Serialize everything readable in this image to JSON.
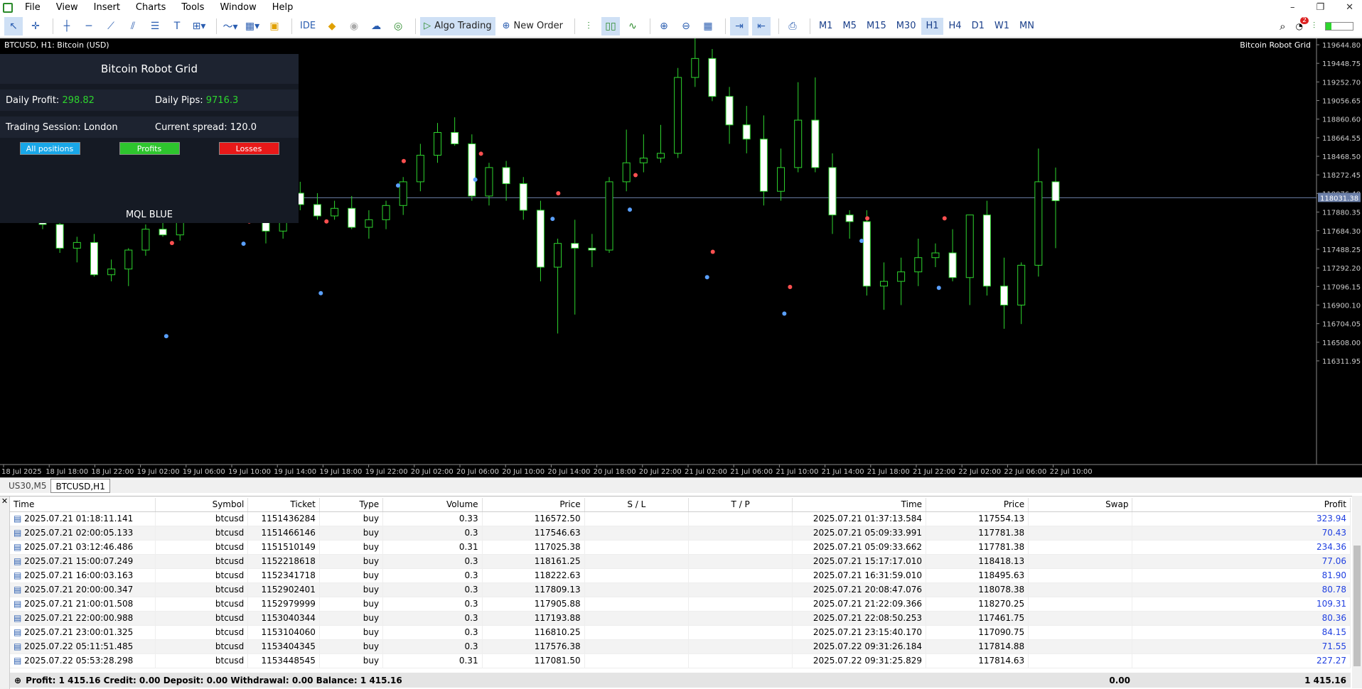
{
  "menu": [
    "File",
    "View",
    "Insert",
    "Charts",
    "Tools",
    "Window",
    "Help"
  ],
  "toolbar": {
    "ide": "IDE",
    "algo": "Algo Trading",
    "new_order": "New Order",
    "timeframes": [
      "M1",
      "M5",
      "M15",
      "M30",
      "H1",
      "H4",
      "D1",
      "W1",
      "MN"
    ],
    "active_tf": "H1",
    "notif_count": "2"
  },
  "chart": {
    "title": "BTCUSD, H1:  Bitcoin (USD)",
    "ea_name": "Bitcoin Robot Grid",
    "price_labels": [
      "119644.80",
      "119448.75",
      "119252.70",
      "119056.65",
      "118860.60",
      "118664.55",
      "118468.50",
      "118272.45",
      "118076.40",
      "117880.35",
      "117684.30",
      "117488.25",
      "117292.20",
      "117096.15",
      "116900.10",
      "116704.05",
      "116508.00",
      "116311.95"
    ],
    "current_price": "118031.38",
    "time_labels": [
      "18 Jul 2025",
      "18 Jul 18:00",
      "18 Jul 22:00",
      "19 Jul 02:00",
      "19 Jul 06:00",
      "19 Jul 10:00",
      "19 Jul 14:00",
      "19 Jul 18:00",
      "19 Jul 22:00",
      "20 Jul 02:00",
      "20 Jul 06:00",
      "20 Jul 10:00",
      "20 Jul 14:00",
      "20 Jul 18:00",
      "20 Jul 22:00",
      "21 Jul 02:00",
      "21 Jul 06:00",
      "21 Jul 10:00",
      "21 Jul 14:00",
      "21 Jul 18:00",
      "21 Jul 22:00",
      "22 Jul 02:00",
      "22 Jul 06:00",
      "22 Jul 10:00"
    ]
  },
  "panel": {
    "title": "Bitcoin Robot Grid",
    "daily_profit_label": "Daily Profit:",
    "daily_profit": "298.82",
    "daily_pips_label": "Daily Pips:",
    "daily_pips": "9716.3",
    "session": "Trading Session: London",
    "spread": "Current spread: 120.0",
    "btn_all": "All positions",
    "btn_profits": "Profits",
    "btn_losses": "Losses",
    "footer": "MQL BLUE"
  },
  "chart_tabs": [
    "US30,M5",
    "BTCUSD,H1"
  ],
  "table": {
    "headers": [
      "Time",
      "Symbol",
      "Ticket",
      "Type",
      "Volume",
      "Price",
      "S / L",
      "T / P",
      "Time",
      "Price",
      "Swap",
      "Profit"
    ],
    "rows": [
      [
        "2025.07.21 01:18:11.141",
        "btcusd",
        "1151436284",
        "buy",
        "0.33",
        "116572.50",
        "",
        "",
        "2025.07.21 01:37:13.584",
        "117554.13",
        "",
        "323.94"
      ],
      [
        "2025.07.21 02:00:05.133",
        "btcusd",
        "1151466146",
        "buy",
        "0.3",
        "117546.63",
        "",
        "",
        "2025.07.21 05:09:33.991",
        "117781.38",
        "",
        "70.43"
      ],
      [
        "2025.07.21 03:12:46.486",
        "btcusd",
        "1151510149",
        "buy",
        "0.31",
        "117025.38",
        "",
        "",
        "2025.07.21 05:09:33.662",
        "117781.38",
        "",
        "234.36"
      ],
      [
        "2025.07.21 15:00:07.249",
        "btcusd",
        "1152218618",
        "buy",
        "0.3",
        "118161.25",
        "",
        "",
        "2025.07.21 15:17:17.010",
        "118418.13",
        "",
        "77.06"
      ],
      [
        "2025.07.21 16:00:03.163",
        "btcusd",
        "1152341718",
        "buy",
        "0.3",
        "118222.63",
        "",
        "",
        "2025.07.21 16:31:59.010",
        "118495.63",
        "",
        "81.90"
      ],
      [
        "2025.07.21 20:00:00.347",
        "btcusd",
        "1152902401",
        "buy",
        "0.3",
        "117809.13",
        "",
        "",
        "2025.07.21 20:08:47.076",
        "118078.38",
        "",
        "80.78"
      ],
      [
        "2025.07.21 21:00:01.508",
        "btcusd",
        "1152979999",
        "buy",
        "0.3",
        "117905.88",
        "",
        "",
        "2025.07.21 21:22:09.366",
        "118270.25",
        "",
        "109.31"
      ],
      [
        "2025.07.21 22:00:00.988",
        "btcusd",
        "1153040344",
        "buy",
        "0.3",
        "117193.88",
        "",
        "",
        "2025.07.21 22:08:50.253",
        "117461.75",
        "",
        "80.36"
      ],
      [
        "2025.07.21 23:00:01.325",
        "btcusd",
        "1153104060",
        "buy",
        "0.3",
        "116810.25",
        "",
        "",
        "2025.07.21 23:15:40.170",
        "117090.75",
        "",
        "84.15"
      ],
      [
        "2025.07.22 05:11:51.485",
        "btcusd",
        "1153404345",
        "buy",
        "0.3",
        "117576.38",
        "",
        "",
        "2025.07.22 09:31:26.184",
        "117814.88",
        "",
        "71.55"
      ],
      [
        "2025.07.22 05:53:28.298",
        "btcusd",
        "1153448545",
        "buy",
        "0.31",
        "117081.50",
        "",
        "",
        "2025.07.22 09:31:25.829",
        "117814.63",
        "",
        "227.27"
      ]
    ]
  },
  "summary": {
    "text": "Profit: 1 415.16  Credit: 0.00  Deposit: 0.00  Withdrawal: 0.00  Balance: 1 415.16",
    "swap": "0.00",
    "profit": "1 415.16"
  },
  "candles": [
    [
      118200,
      118260,
      117700,
      117750
    ],
    [
      117750,
      117850,
      117450,
      117500
    ],
    [
      117500,
      117620,
      117350,
      117560
    ],
    [
      117560,
      117650,
      117200,
      117220
    ],
    [
      117220,
      117380,
      117150,
      117280
    ],
    [
      117280,
      117500,
      117100,
      117480
    ],
    [
      117480,
      117750,
      117420,
      117700
    ],
    [
      117700,
      117900,
      117620,
      117640
    ],
    [
      117640,
      118300,
      117580,
      118150
    ],
    [
      118150,
      118350,
      118000,
      118070
    ],
    [
      118070,
      118380,
      117950,
      118250
    ],
    [
      118250,
      118300,
      118100,
      118220
    ],
    [
      118220,
      118320,
      118150,
      118200
    ],
    [
      118200,
      118400,
      117550,
      117680
    ],
    [
      117680,
      118120,
      117600,
      118080
    ],
    [
      118080,
      118200,
      117900,
      117960
    ],
    [
      117960,
      118080,
      117800,
      117840
    ],
    [
      117840,
      118000,
      117800,
      117920
    ],
    [
      117920,
      118050,
      117700,
      117720
    ],
    [
      117720,
      117900,
      117600,
      117800
    ],
    [
      117800,
      118000,
      117700,
      117950
    ],
    [
      117950,
      118250,
      117850,
      118200
    ],
    [
      118200,
      118600,
      118100,
      118480
    ],
    [
      118480,
      118820,
      118400,
      118720
    ],
    [
      118720,
      118880,
      118580,
      118600
    ],
    [
      118600,
      118700,
      118000,
      118050
    ],
    [
      118050,
      118400,
      117950,
      118350
    ],
    [
      118350,
      118420,
      118000,
      118180
    ],
    [
      118180,
      118250,
      117800,
      117900
    ],
    [
      117900,
      118000,
      117150,
      117300
    ],
    [
      117300,
      117600,
      116600,
      117550
    ],
    [
      117550,
      117800,
      116800,
      117500
    ],
    [
      117500,
      117650,
      117300,
      117480
    ],
    [
      117480,
      118250,
      117450,
      118200
    ],
    [
      118200,
      118750,
      118100,
      118400
    ],
    [
      118400,
      118700,
      118300,
      118450
    ],
    [
      118450,
      118800,
      118400,
      118500
    ],
    [
      118500,
      119400,
      118450,
      119300
    ],
    [
      119300,
      119750,
      119200,
      119500
    ],
    [
      119500,
      119600,
      119050,
      119100
    ],
    [
      119100,
      119200,
      118600,
      118800
    ],
    [
      118800,
      119000,
      118500,
      118650
    ],
    [
      118650,
      118900,
      117950,
      118100
    ],
    [
      118100,
      118550,
      118000,
      118350
    ],
    [
      118350,
      119250,
      118300,
      118850
    ],
    [
      118850,
      119300,
      118300,
      118350
    ],
    [
      118350,
      118500,
      117650,
      117850
    ],
    [
      117850,
      117900,
      117600,
      117780
    ],
    [
      117780,
      117900,
      117000,
      117100
    ],
    [
      117100,
      117350,
      116850,
      117150
    ],
    [
      117150,
      117400,
      116900,
      117250
    ],
    [
      117250,
      117600,
      117100,
      117400
    ],
    [
      117400,
      117550,
      117300,
      117450
    ],
    [
      117450,
      117700,
      117150,
      117190
    ],
    [
      117190,
      117800,
      116900,
      117850
    ],
    [
      117850,
      118000,
      117000,
      117100
    ],
    [
      117100,
      117400,
      116650,
      116900
    ],
    [
      116900,
      117350,
      116700,
      117320
    ],
    [
      117320,
      118550,
      117200,
      118200
    ],
    [
      118200,
      118350,
      117500,
      118000
    ]
  ]
}
